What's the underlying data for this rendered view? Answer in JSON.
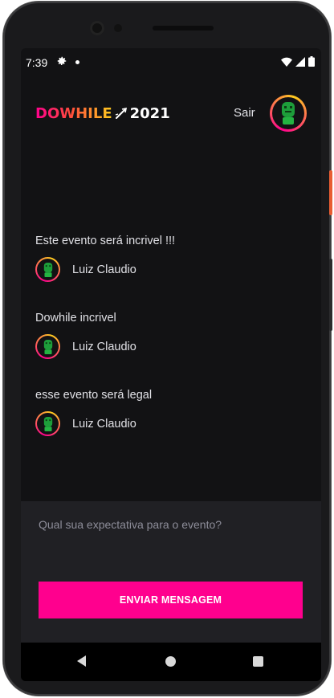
{
  "status_bar": {
    "time": "7:39"
  },
  "header": {
    "logo_text": "DOWHILE",
    "logo_year": "2021",
    "signout_label": "Sair"
  },
  "messages": [
    {
      "text": "Este evento será incrivel !!!",
      "author": "Luiz Claudio"
    },
    {
      "text": "Dowhile incrivel",
      "author": "Luiz Claudio"
    },
    {
      "text": "esse evento será legal",
      "author": "Luiz Claudio"
    }
  ],
  "form": {
    "placeholder": "Qual sua expectativa para o evento?",
    "value": "",
    "send_label": "ENVIAR MENSAGEM"
  },
  "colors": {
    "accent": "#ff008e",
    "accent_secondary": "#ffcd1e",
    "background": "#121214",
    "form_background": "#202024"
  },
  "icons": {
    "status": [
      "gear-icon",
      "wifi-icon",
      "cell-signal-icon",
      "battery-icon"
    ],
    "nav": [
      "back-icon",
      "home-icon",
      "recents-icon"
    ]
  }
}
